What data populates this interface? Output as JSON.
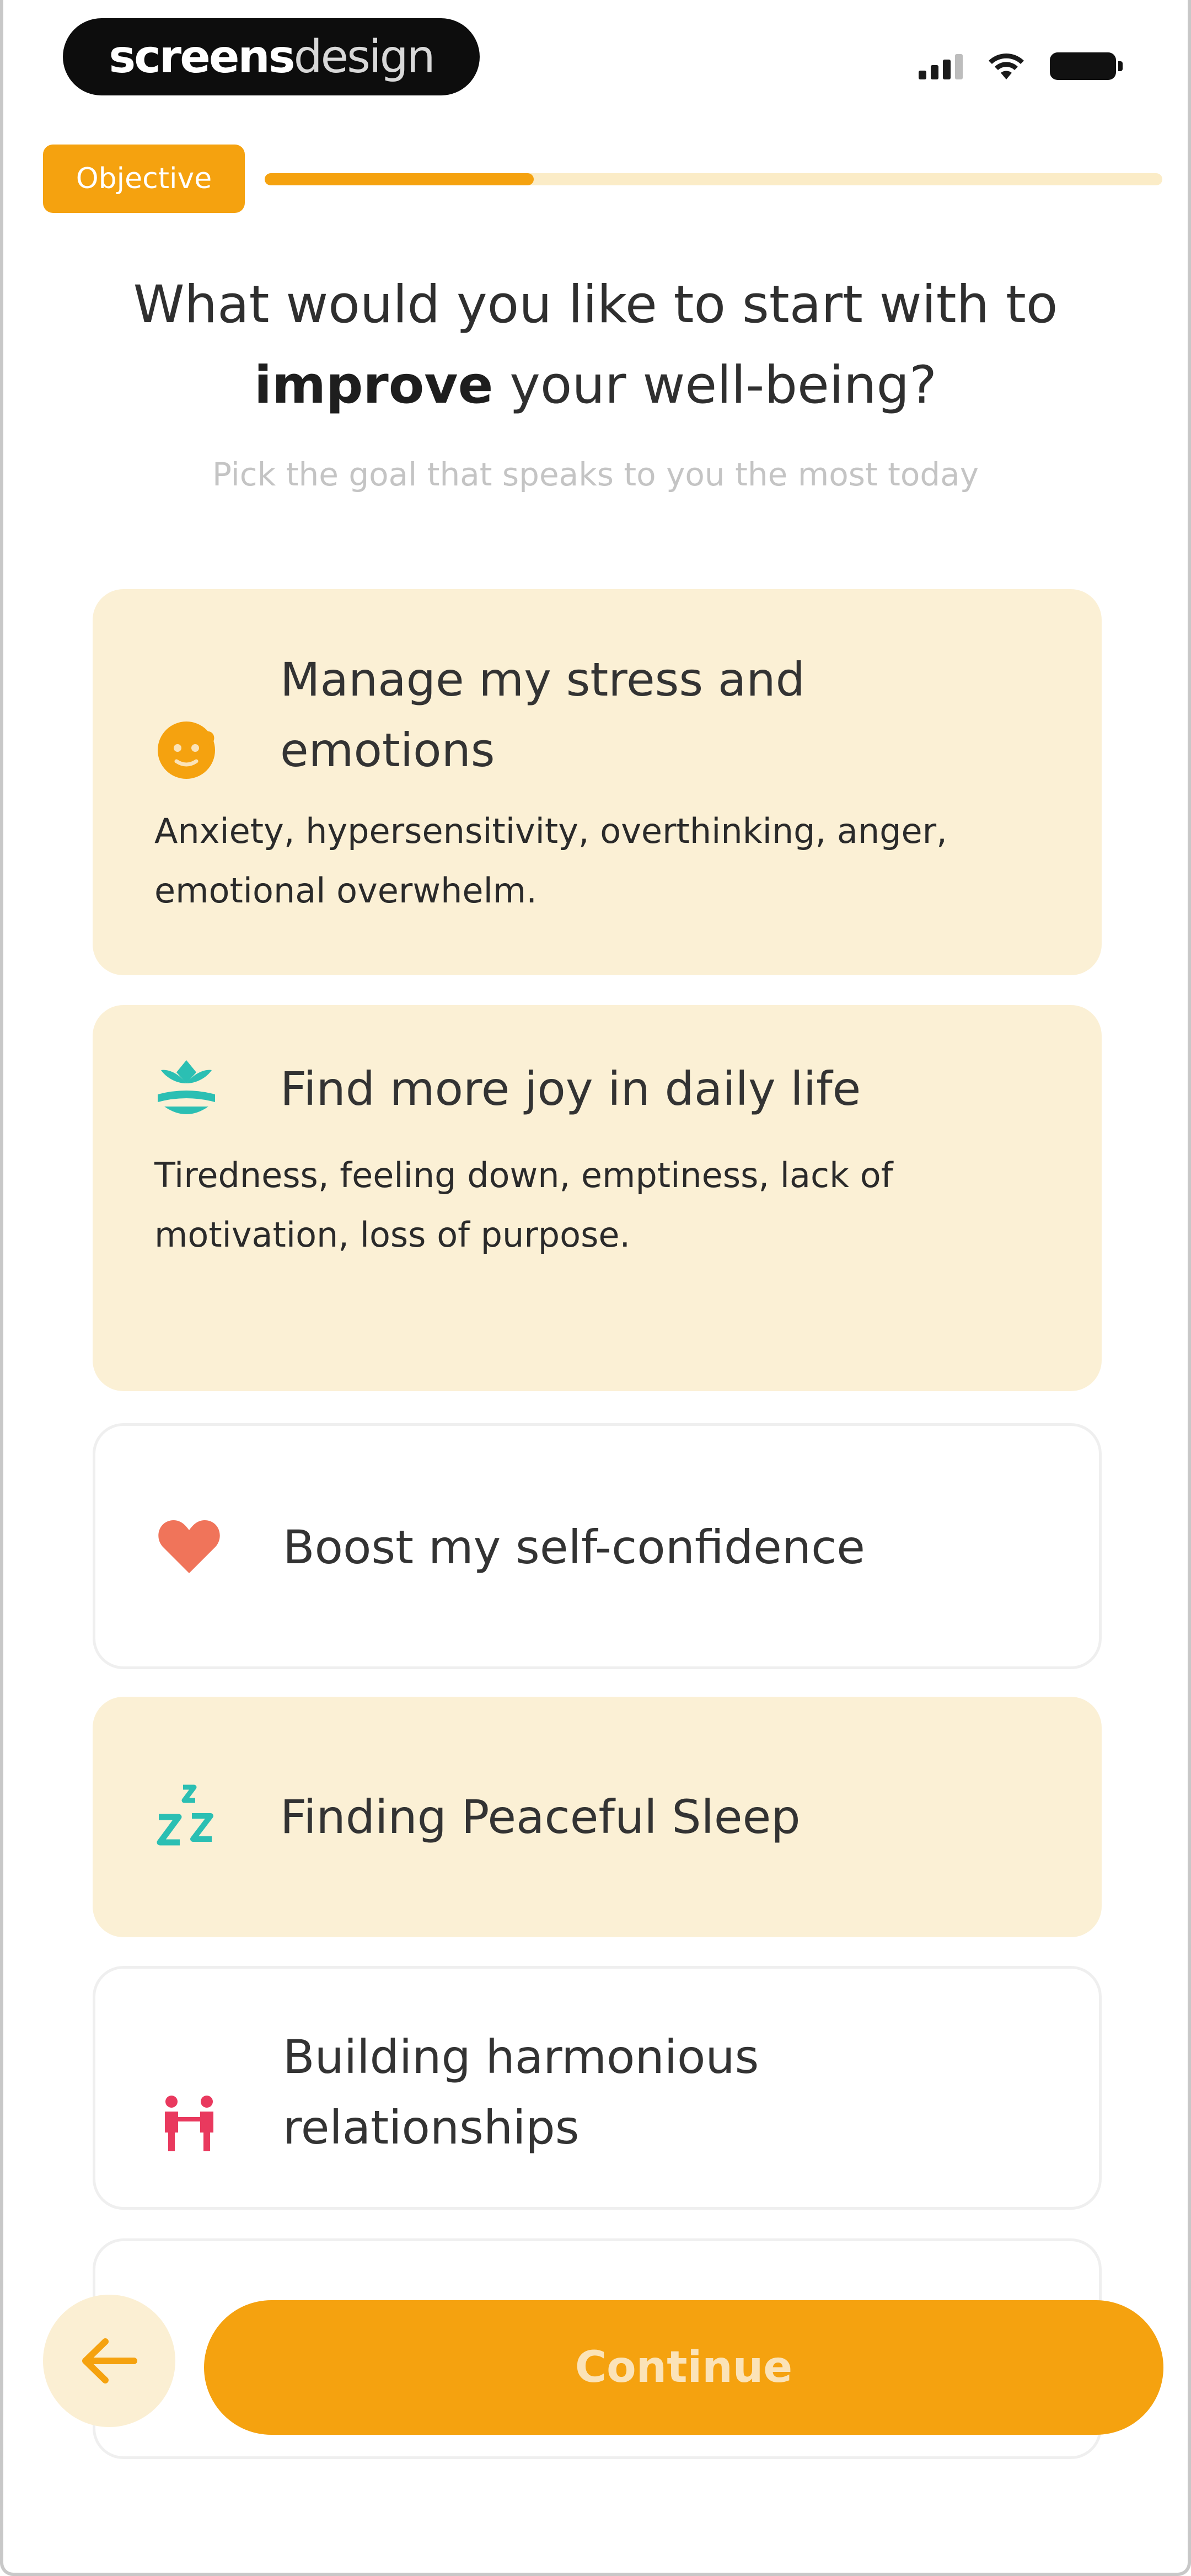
{
  "status_bar": {
    "brand_bold": "screens",
    "brand_light": "design",
    "icons": [
      "signal-icon",
      "wifi-icon",
      "battery-icon"
    ]
  },
  "progress": {
    "tag_label": "Objective",
    "value": 0.3
  },
  "header": {
    "question_part1": "What would you like to start with to",
    "question_bold": "improve",
    "question_part2": " your well-being?",
    "subtitle": "Pick the goal that speaks to you the most today"
  },
  "options": [
    {
      "title": "Manage my stress and emotions",
      "description": "Anxiety, hypersensitivity, overthinking, anger, emotional overwhelm.",
      "icon": "face-emotion-icon",
      "highlighted": true
    },
    {
      "title": "Find more joy in daily life",
      "description": "Tiredness, feeling down, emptiness, lack of motivation, loss of purpose.",
      "icon": "lotus-icon",
      "highlighted": true
    },
    {
      "title": "Boost my self-confidence",
      "icon": "heart-icon",
      "highlighted": false
    },
    {
      "title": "Finding Peaceful Sleep",
      "icon": "sleep-zzz-icon",
      "highlighted": true
    },
    {
      "title": "Building harmonious relationships",
      "icon": "people-icon",
      "highlighted": false
    }
  ],
  "footer": {
    "continue_label": "Continue",
    "back_icon": "arrow-left-icon"
  },
  "colors": {
    "accent": "#f5a20f",
    "highlight_bg": "#fbf0d5",
    "teal": "#2bbfb3",
    "coral": "#f0745a",
    "pink": "#e9395e"
  }
}
